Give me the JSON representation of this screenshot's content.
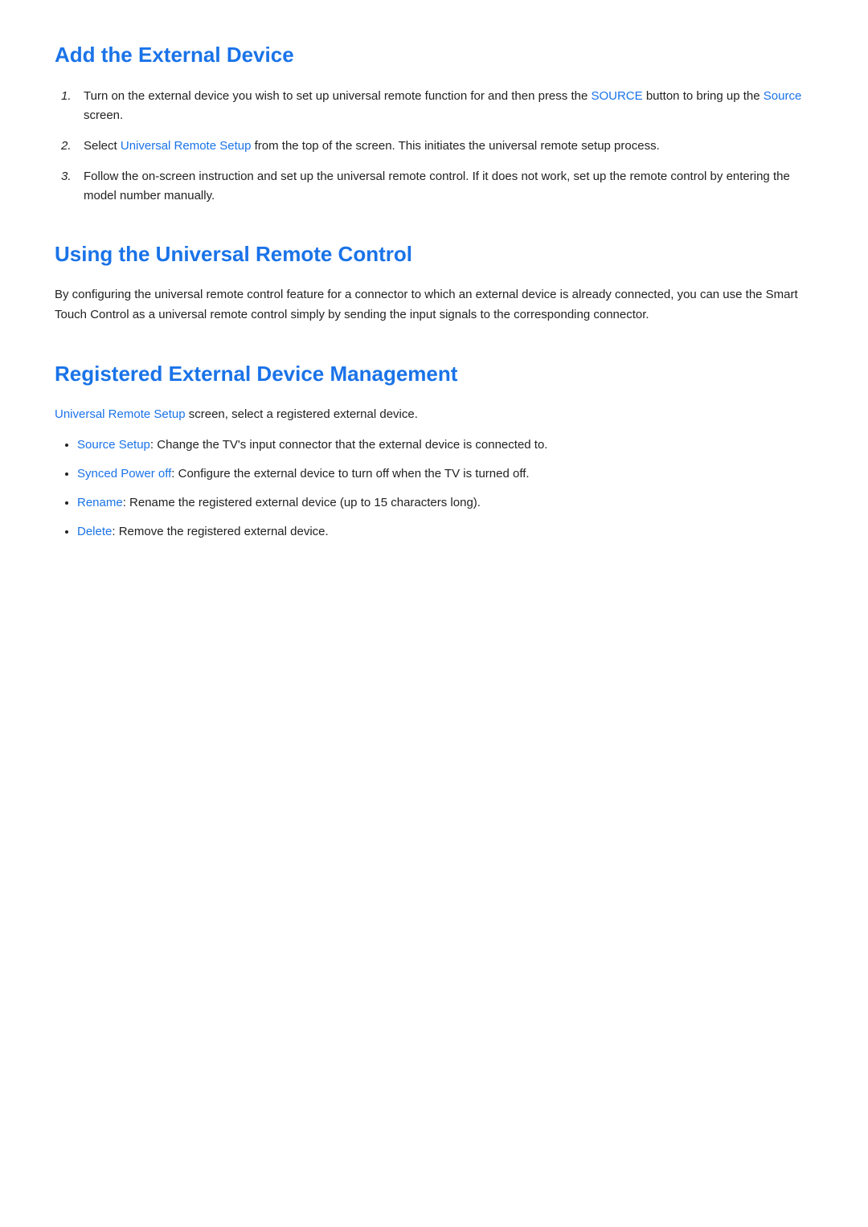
{
  "section1": {
    "title": "Add the External Device",
    "items": [
      {
        "number": "1.",
        "parts": [
          {
            "text": "Turn on the external device you wish to set up universal remote function for and then press the ",
            "highlight": false
          },
          {
            "text": "SOURCE",
            "highlight": true
          },
          {
            "text": " button to bring up the ",
            "highlight": false
          },
          {
            "text": "Source",
            "highlight": true
          },
          {
            "text": " screen.",
            "highlight": false
          }
        ]
      },
      {
        "number": "2.",
        "parts": [
          {
            "text": "Select ",
            "highlight": false
          },
          {
            "text": "Universal Remote Setup",
            "highlight": true
          },
          {
            "text": " from the top of the screen. This initiates the universal remote setup process.",
            "highlight": false
          }
        ]
      },
      {
        "number": "3.",
        "parts": [
          {
            "text": "Follow the on-screen instruction and set up the universal remote control. If it does not work, set up the remote control by entering the model number manually.",
            "highlight": false
          }
        ]
      }
    ]
  },
  "section2": {
    "title": "Using the Universal Remote Control",
    "body": "By configuring the universal remote control feature for a connector to which an external device is already connected, you can use the Smart Touch Control as a universal remote control simply by sending the input signals to the corresponding connector."
  },
  "section3": {
    "title": "Registered External Device Management",
    "intro_parts": [
      {
        "text": "Universal Remote Setup",
        "highlight": true
      },
      {
        "text": " screen, select a registered external device.",
        "highlight": false
      }
    ],
    "items": [
      {
        "link": "Source Setup",
        "rest": ": Change the TV’s input connector that the external device is connected to."
      },
      {
        "link": "Synced Power off",
        "rest": ": Configure the external device to turn off when the TV is turned off."
      },
      {
        "link": "Rename",
        "rest": ": Rename the registered external device (up to 15 characters long)."
      },
      {
        "link": "Delete",
        "rest": ": Remove the registered external device."
      }
    ]
  },
  "colors": {
    "blue": "#1a73e8",
    "text": "#222222"
  }
}
